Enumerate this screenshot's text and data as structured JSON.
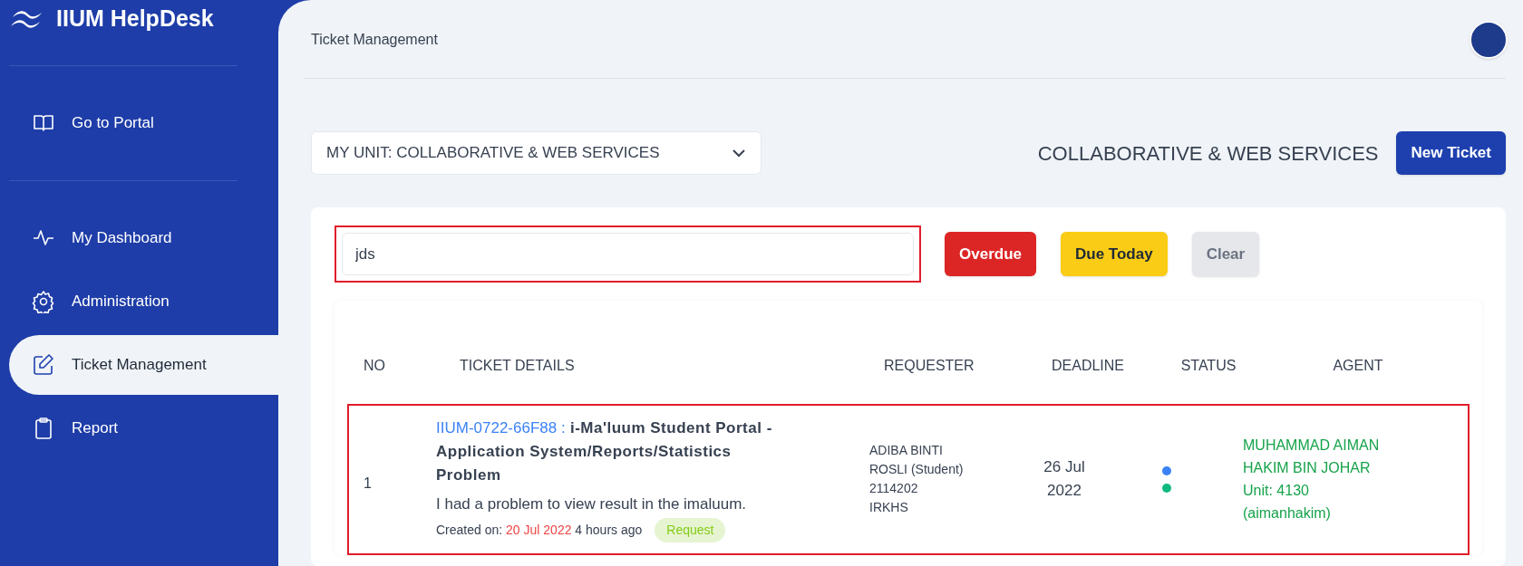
{
  "brand": {
    "title": "IIUM HelpDesk"
  },
  "sidebar": {
    "top_items": [
      {
        "label": "Go to Portal",
        "selected": false
      }
    ],
    "items": [
      {
        "label": "My Dashboard",
        "selected": false
      },
      {
        "label": "Administration",
        "selected": false
      },
      {
        "label": "Ticket Management",
        "selected": true
      },
      {
        "label": "Report",
        "selected": false
      }
    ]
  },
  "header": {
    "title": "Ticket Management"
  },
  "unit_select": {
    "value": "MY UNIT: COLLABORATIVE & WEB SERVICES"
  },
  "unit_heading": "COLLABORATIVE & WEB SERVICES",
  "new_ticket_button": "New Ticket",
  "search": {
    "value": "jds",
    "highlighted": true
  },
  "filters": [
    {
      "label": "Overdue",
      "kind": "danger"
    },
    {
      "label": "Due Today",
      "kind": "warning"
    },
    {
      "label": "Clear",
      "kind": "neutral"
    }
  ],
  "table": {
    "columns": [
      "NO",
      "TICKET DETAILS",
      "REQUESTER",
      "DEADLINE",
      "STATUS",
      "AGENT"
    ],
    "rows": [
      {
        "highlighted": true,
        "no": "1",
        "ticket_id": "IIUM-0722-66F88 :",
        "subject": "i-Ma'luum Student Portal - Application System/Reports/Statistics Problem",
        "description": "I had a problem to view result in the imaluum.",
        "created_label": "Created on:",
        "created_date": "20 Jul 2022",
        "age": "4 hours ago",
        "tag": "Request",
        "requester": [
          "ADIBA BINTI",
          "ROSLI (Student)",
          "2114202",
          "IRKHS"
        ],
        "deadline": "26 Jul 2022",
        "status": [
          {
            "color": "#3b82f6"
          },
          {
            "color": "#10b981"
          }
        ],
        "agent": [
          "MUHAMMAD AIMAN",
          "HAKIM BIN JOHAR",
          "Unit: 4130",
          "(aimanhakim)"
        ]
      }
    ]
  }
}
